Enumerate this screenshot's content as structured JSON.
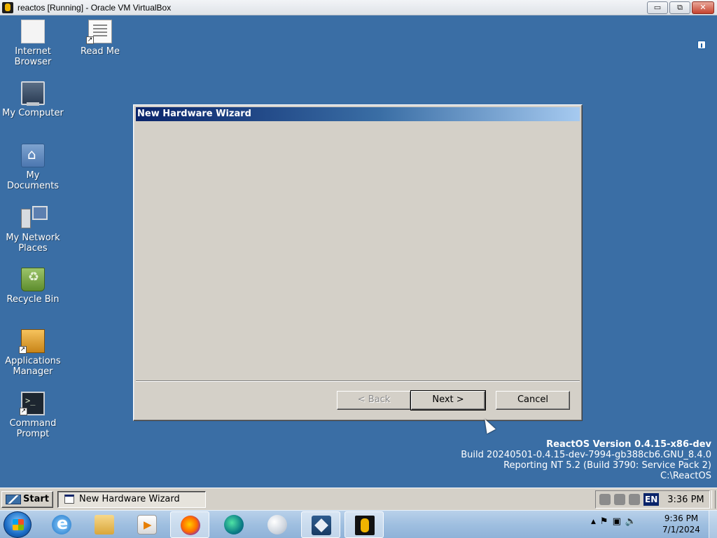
{
  "host_window": {
    "title": "reactos [Running] - Oracle VM VirtualBox",
    "buttons": {
      "minimize": "▭",
      "restore": "⧉",
      "close": "✕"
    }
  },
  "desktop_icons": [
    {
      "id": "internet-browser",
      "label": "Internet Browser",
      "icon": "browser-icon"
    },
    {
      "id": "read-me",
      "label": "Read Me",
      "icon": "document-icon"
    },
    {
      "id": "my-computer",
      "label": "My Computer",
      "icon": "computer-icon"
    },
    {
      "id": "my-documents",
      "label": "My Documents",
      "icon": "folder-icon"
    },
    {
      "id": "my-network-places",
      "label": "My Network Places",
      "icon": "network-icon"
    },
    {
      "id": "recycle-bin",
      "label": "Recycle Bin",
      "icon": "recycle-bin-icon"
    },
    {
      "id": "applications-manager",
      "label": "Applications Manager",
      "icon": "package-icon"
    },
    {
      "id": "command-prompt",
      "label": "Command Prompt",
      "icon": "terminal-icon"
    }
  ],
  "wizard": {
    "title": "New Hardware Wizard",
    "back_label": "< Back",
    "next_label": "Next >",
    "cancel_label": "Cancel"
  },
  "version_info": {
    "line1": "ReactOS Version 0.4.15-x86-dev",
    "line2": "Build 20240501-0.4.15-dev-7994-gb388cb6.GNU_8.4.0",
    "line3": "Reporting NT 5.2 (Build 3790: Service Pack 2)",
    "line4": "C:\\ReactOS"
  },
  "ros_taskbar": {
    "start_label": "Start",
    "task_label": "New Hardware Wizard",
    "language": "EN",
    "time": "3:36 PM"
  },
  "host_taskbar": {
    "pinned": [
      "Internet Explorer",
      "Windows Explorer",
      "Windows Media Player",
      "Firefox",
      "Edge",
      "Sphere app",
      "VirtualBox Manager",
      "reactos VM"
    ],
    "tray_arrow": "▲",
    "time": "9:36 PM",
    "date": "7/1/2024"
  },
  "colors": {
    "desktop": "#3a6ea5",
    "title_active": "#0a246a",
    "face": "#d4d0c8"
  }
}
